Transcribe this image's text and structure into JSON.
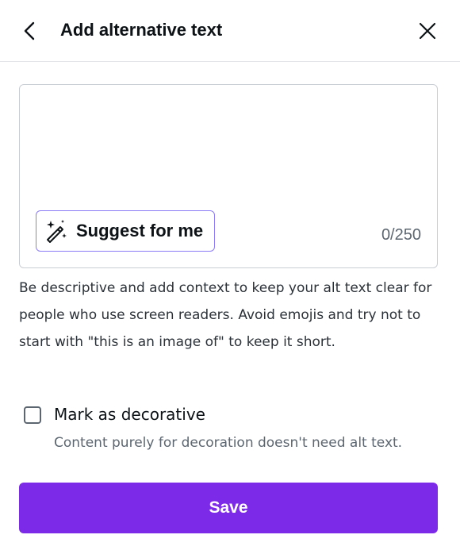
{
  "header": {
    "title": "Add alternative text",
    "back_icon": "chevron-left-icon",
    "close_icon": "close-icon"
  },
  "alt_text": {
    "value": "",
    "counter": "0/250",
    "suggest_label": "Suggest for me",
    "suggest_icon": "magic-wand-sparkle-icon"
  },
  "help_text": "Be descriptive and add context to keep your alt text clear for people who use screen readers. Avoid emojis and try not to start with \"this is an image of\" to keep it short.",
  "decorative": {
    "label": "Mark as decorative",
    "checked": false,
    "description": "Content purely for decoration doesn't need alt text."
  },
  "save_label": "Save",
  "colors": {
    "accent": "#7d2ae8",
    "suggest_border": "#8b7cf6"
  }
}
